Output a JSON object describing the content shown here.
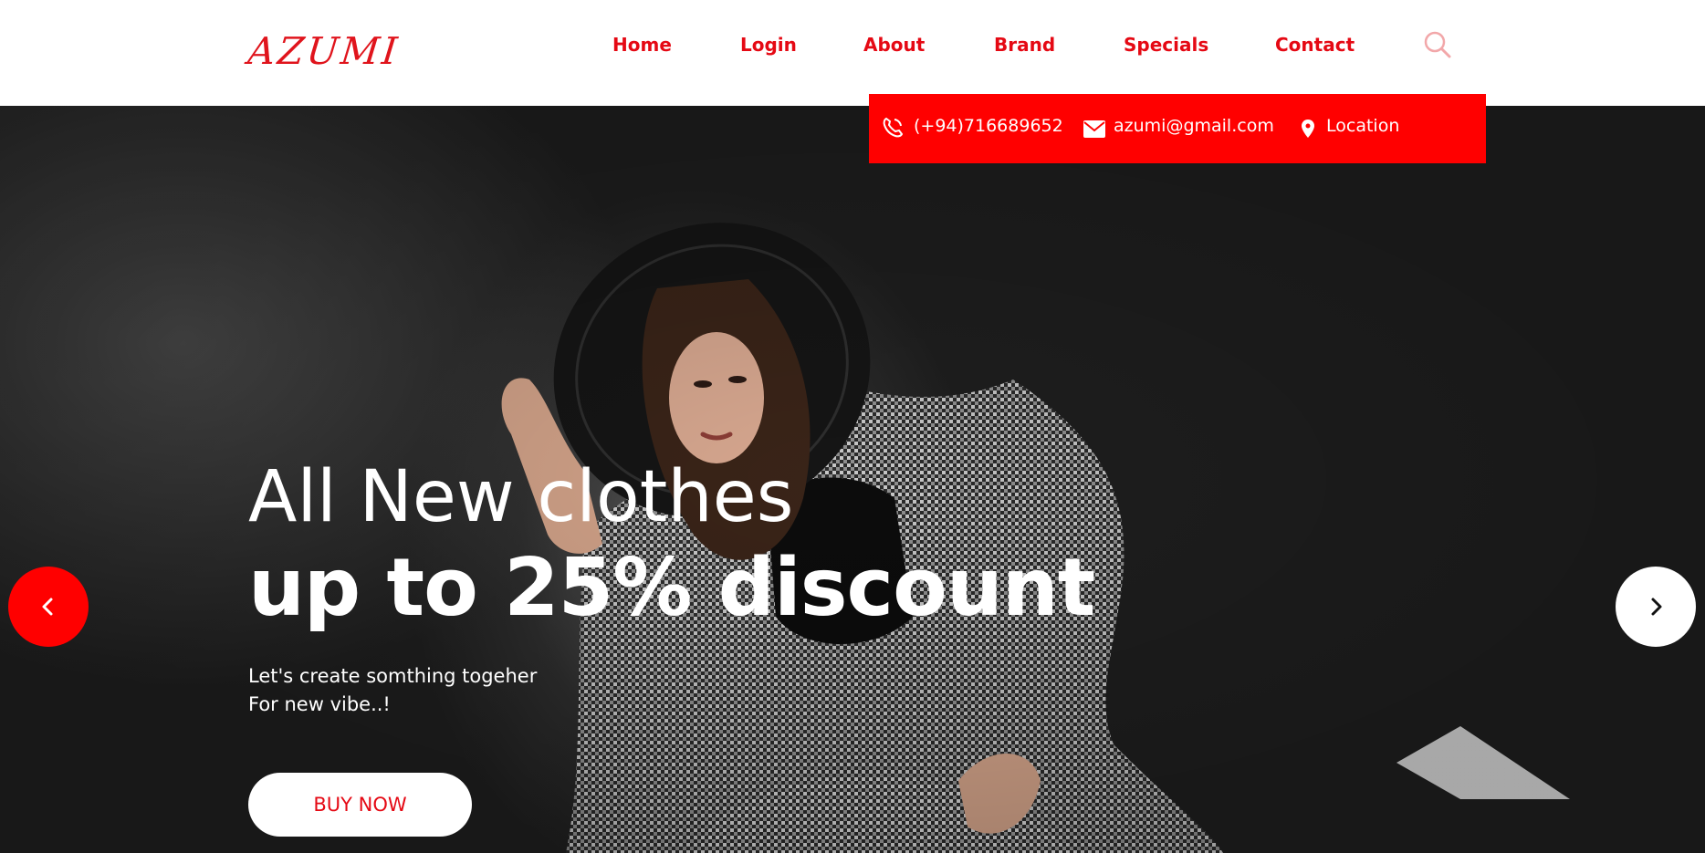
{
  "brand": {
    "logo_text": "AZUMI",
    "accent_color": "#e50914"
  },
  "nav": {
    "items": [
      {
        "label": "Home"
      },
      {
        "label": "Login"
      },
      {
        "label": "About"
      },
      {
        "label": "Brand"
      },
      {
        "label": "Specials"
      },
      {
        "label": "Contact"
      }
    ],
    "search_icon": "search-icon"
  },
  "contact_bar": {
    "background": "#ff0000",
    "phone": "(+94)716689652",
    "email": "azumi@gmail.com",
    "location": "Location",
    "icons": [
      "phone-icon",
      "mail-icon",
      "location-pin-icon"
    ]
  },
  "hero": {
    "headline_line1": "All New clothes",
    "headline_line2": "up to 25% discount",
    "subtext_line1": "Let's create somthing togeher",
    "subtext_line2": "For new vibe..!",
    "cta_label": "BUY NOW",
    "prev_icon": "chevron-left-icon",
    "next_icon": "chevron-right-icon",
    "image": "woman-in-black-hat-and-houndstooth-coat"
  }
}
